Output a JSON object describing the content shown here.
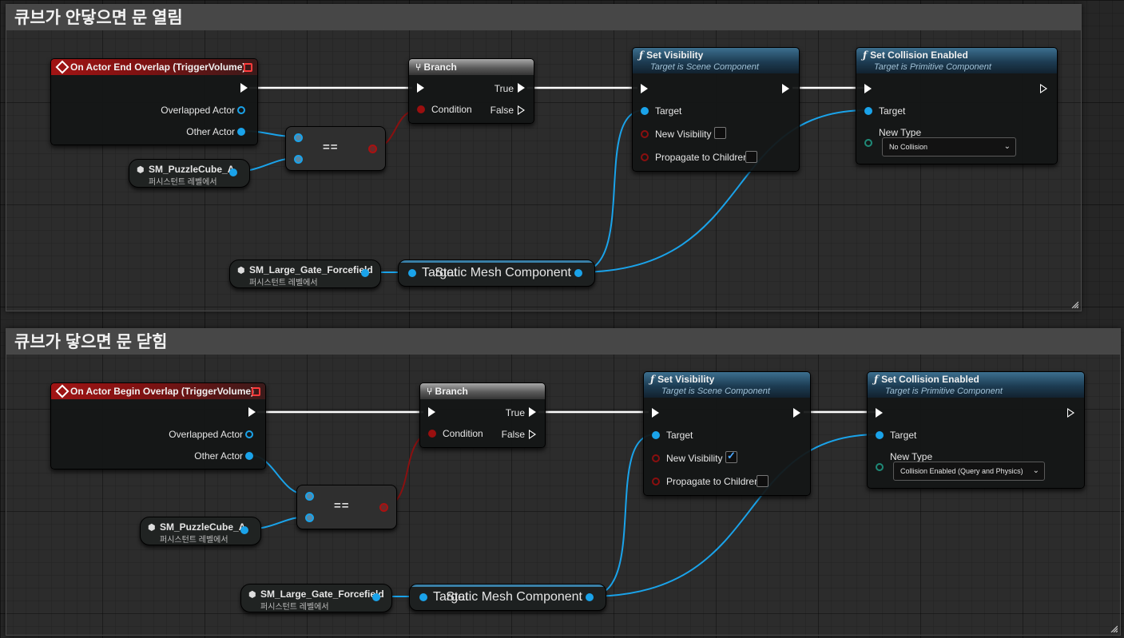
{
  "comments": [
    {
      "title": "큐브가 안닿으면 문 열림",
      "event": {
        "title": "On Actor End Overlap (TriggerVolume)",
        "overlapped_actor": "Overlapped Actor",
        "other_actor": "Other Actor"
      },
      "cube_ref": {
        "name": "SM_PuzzleCube_A",
        "sub": "퍼시스턴트 레벨에서"
      },
      "equals": {
        "symbol": "=="
      },
      "branch": {
        "title": "Branch",
        "true_label": "True",
        "condition_label": "Condition",
        "false_label": "False"
      },
      "gate_ref": {
        "name": "SM_Large_Gate_Forcefield",
        "sub": "퍼시스턴트 레벨에서"
      },
      "getter": {
        "target_label": "Target",
        "output_label": "Static Mesh Component"
      },
      "set_visibility": {
        "title": "Set Visibility",
        "subtitle": "Target is Scene Component",
        "target_label": "Target",
        "new_visibility_label": "New Visibility",
        "new_visibility_checked": false,
        "propagate_label": "Propagate to Children",
        "propagate_checked": false
      },
      "set_collision": {
        "title": "Set Collision Enabled",
        "subtitle": "Target is Primitive Component",
        "target_label": "Target",
        "new_type_label": "New Type",
        "new_type_value": "No Collision"
      }
    },
    {
      "title": "큐브가 닿으면 문 닫힘",
      "event": {
        "title": "On Actor Begin Overlap (TriggerVolume)",
        "overlapped_actor": "Overlapped Actor",
        "other_actor": "Other Actor"
      },
      "cube_ref": {
        "name": "SM_PuzzleCube_A",
        "sub": "퍼시스턴트 레벨에서"
      },
      "equals": {
        "symbol": "=="
      },
      "branch": {
        "title": "Branch",
        "true_label": "True",
        "condition_label": "Condition",
        "false_label": "False"
      },
      "gate_ref": {
        "name": "SM_Large_Gate_Forcefield",
        "sub": "퍼시스턴트 레벨에서"
      },
      "getter": {
        "target_label": "Target",
        "output_label": "Static Mesh Component"
      },
      "set_visibility": {
        "title": "Set Visibility",
        "subtitle": "Target is Scene Component",
        "target_label": "Target",
        "new_visibility_label": "New Visibility",
        "new_visibility_checked": true,
        "propagate_label": "Propagate to Children",
        "propagate_checked": false
      },
      "set_collision": {
        "title": "Set Collision Enabled",
        "subtitle": "Target is Primitive Component",
        "target_label": "Target",
        "new_type_label": "New Type",
        "new_type_value": "Collision Enabled (Query and Physics)"
      }
    }
  ],
  "colors": {
    "exec_wire": "#ffffff",
    "object_wire": "#1aa3ea",
    "bool_wire": "#8a1010",
    "event_header": "#a11414",
    "function_header": "#3c6f8f"
  },
  "icons": {
    "event": "event-diamond-icon",
    "branch": "branch-icon",
    "function": "function-icon",
    "actor": "actor-cube-icon",
    "close": "close-icon",
    "dropdown": "chevron-down-icon",
    "resize": "resize-grip-icon"
  }
}
